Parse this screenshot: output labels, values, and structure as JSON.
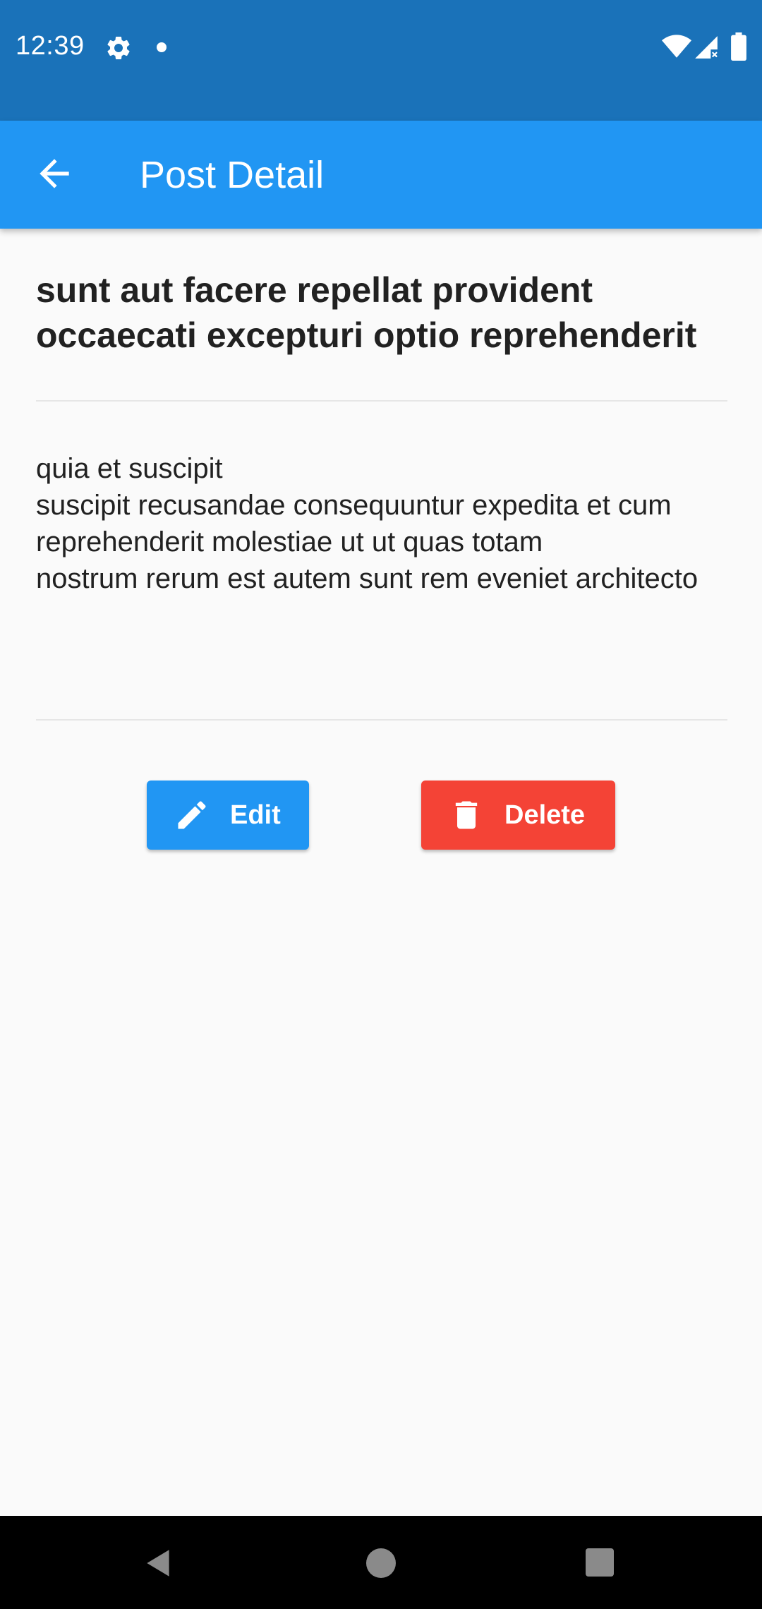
{
  "status_bar": {
    "time": "12:39",
    "icons": [
      "gear-icon",
      "notification-dot",
      "wifi-icon",
      "signal-icon",
      "battery-icon"
    ]
  },
  "app_bar": {
    "title": "Post Detail",
    "back_icon": "arrow-left-icon",
    "color": "#2196f3"
  },
  "post": {
    "title": "sunt aut facere repellat provident occaecati excepturi optio reprehenderit",
    "body": "quia et suscipit\nsuscipit recusandae consequuntur expedita et cum\nreprehenderit molestiae ut ut quas totam\nnostrum rerum est autem sunt rem eveniet architecto"
  },
  "actions": {
    "edit_label": "Edit",
    "edit_icon": "pencil-icon",
    "edit_color": "#2196f3",
    "delete_label": "Delete",
    "delete_icon": "trash-icon",
    "delete_color": "#f44336"
  },
  "nav_bar": {
    "icons": [
      "back-triangle-icon",
      "home-circle-icon",
      "recents-square-icon"
    ]
  }
}
